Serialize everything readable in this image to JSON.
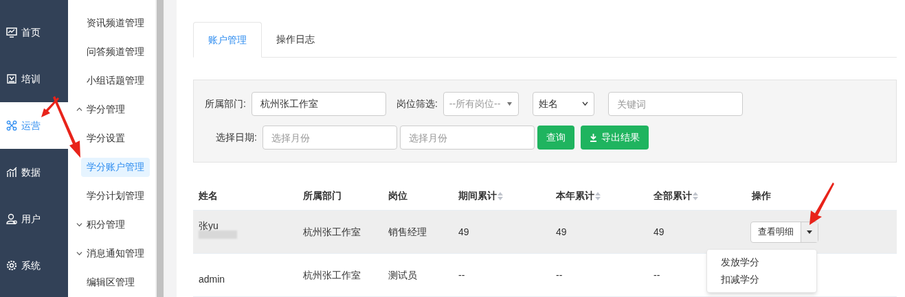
{
  "nav": [
    {
      "label": "首页",
      "selected": false
    },
    {
      "label": "培训",
      "selected": false
    },
    {
      "label": "运营",
      "selected": true
    },
    {
      "label": "数据",
      "selected": false
    },
    {
      "label": "用户",
      "selected": false
    },
    {
      "label": "系统",
      "selected": false
    }
  ],
  "submenu": [
    {
      "kind": "link",
      "label": "资讯频道管理",
      "selected": false
    },
    {
      "kind": "link",
      "label": "问答频道管理",
      "selected": false
    },
    {
      "kind": "link",
      "label": "小组话题管理",
      "selected": false
    },
    {
      "kind": "group",
      "label": "学分管理",
      "expanded": true
    },
    {
      "kind": "link",
      "label": "学分设置",
      "selected": false
    },
    {
      "kind": "link",
      "label": "学分账户管理",
      "selected": true
    },
    {
      "kind": "link",
      "label": "学分计划管理",
      "selected": false
    },
    {
      "kind": "group",
      "label": "积分管理",
      "expanded": false
    },
    {
      "kind": "group",
      "label": "消息通知管理",
      "expanded": false
    },
    {
      "kind": "link",
      "label": "编辑区管理",
      "selected": false
    }
  ],
  "tabs": [
    {
      "label": "账户管理",
      "selected": true
    },
    {
      "label": "操作日志",
      "selected": false
    }
  ],
  "filters": {
    "department_label": "所属部门:",
    "department_value": "杭州张工作室",
    "position_label": "岗位筛选:",
    "position_select": "--所有岗位--",
    "field_select": "姓名",
    "keyword_placeholder": "关键词",
    "date_label": "选择日期:",
    "start_placeholder": "选择月份",
    "end_placeholder": "选择月份",
    "query_button": "查询",
    "export_button": "导出结果"
  },
  "table": {
    "columns": [
      {
        "label": "姓名",
        "sortable": false
      },
      {
        "label": "所属部门",
        "sortable": false
      },
      {
        "label": "岗位",
        "sortable": false
      },
      {
        "label": "期间累计",
        "sortable": true
      },
      {
        "label": "本年累计",
        "sortable": true
      },
      {
        "label": "全部累计",
        "sortable": true
      },
      {
        "label": "操作",
        "sortable": false
      }
    ],
    "rows": [
      {
        "name": "张yu",
        "name_blurred": true,
        "department": "杭州张工作室",
        "position": "销售经理",
        "period": "49",
        "year": "49",
        "total": "49",
        "action": "查看明细",
        "selected": true
      },
      {
        "name": "admin",
        "name_blurred": false,
        "department": "杭州张工作室",
        "position": "测试员",
        "period": "--",
        "year": "--",
        "total": "--",
        "selected": false
      }
    ]
  },
  "action_menu": [
    "发放学分",
    "扣减学分"
  ]
}
